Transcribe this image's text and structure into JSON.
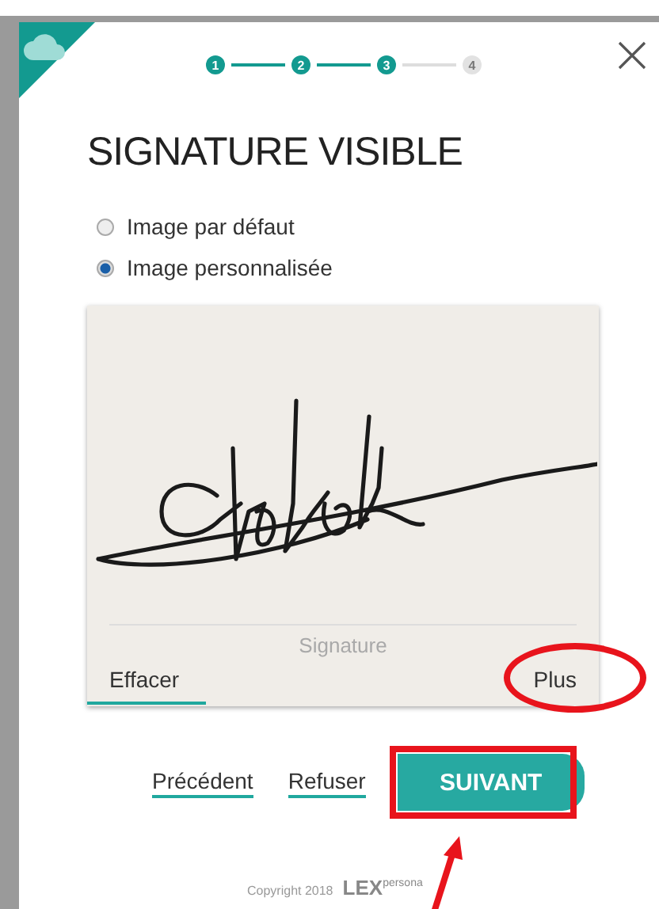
{
  "steps": [
    {
      "label": "1",
      "done": true
    },
    {
      "label": "2",
      "done": true
    },
    {
      "label": "3",
      "done": true
    },
    {
      "label": "4",
      "done": false
    }
  ],
  "title": "SIGNATURE VISIBLE",
  "options": [
    {
      "label": "Image par défaut",
      "selected": false
    },
    {
      "label": "Image personnalisée",
      "selected": true
    }
  ],
  "signature_pad": {
    "placeholder": "Signature",
    "actions": [
      {
        "label": "Effacer",
        "selected": true
      },
      {
        "label": "Plus",
        "selected": false,
        "highlighted": true
      }
    ]
  },
  "buttons": [
    {
      "label": "Précédent",
      "kind": "link",
      "highlighted": false
    },
    {
      "label": "Refuser",
      "kind": "link",
      "highlighted": false
    },
    {
      "label": "SUIVANT",
      "kind": "primary",
      "highlighted": true
    }
  ],
  "footer": {
    "copyright": "Copyright 2018",
    "logo": "LEX$^{persona}$"
  }
}
